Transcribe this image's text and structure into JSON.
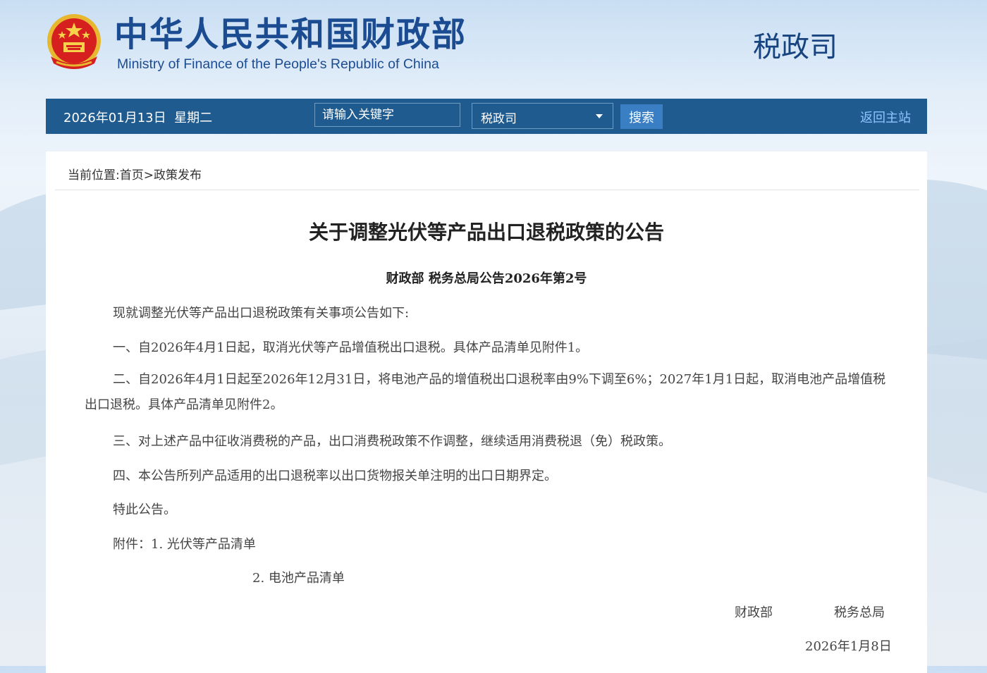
{
  "header": {
    "cn_title": "中华人民共和国财政部",
    "en_title": "Ministry of Finance of the People's Republic of China",
    "department": "税政司",
    "emblem_icon": "national-emblem-icon"
  },
  "navbar": {
    "date": "2026年01月13日",
    "weekday": "星期二",
    "search_placeholder": "请输入关键字",
    "scope_selected": "税政司",
    "search_button": "搜索",
    "home_link": "返回主站"
  },
  "breadcrumb": {
    "prefix": "当前位置:",
    "home": "首页",
    "separator": ">",
    "current": "政策发布"
  },
  "article": {
    "title": "关于调整光伏等产品出口退税政策的公告",
    "doc_number": "财政部 税务总局公告2026年第2号",
    "intro": "现就调整光伏等产品出口退税政策有关事项公告如下:",
    "item1": "一、自2026年4月1日起，取消光伏等产品增值税出口退税。具体产品清单见附件1。",
    "item2": "二、自2026年4月1日起至2026年12月31日，将电池产品的增值税出口退税率由9%下调至6%；2027年1月1日起，取消电池产品增值税出口退税。具体产品清单见附件2。",
    "item3": "三、对上述产品中征收消费税的产品，出口消费税政策不作调整，继续适用消费税退（免）税政策。",
    "item4": "四、本公告所列产品适用的出口退税率以出口货物报关单注明的出口日期界定。",
    "closing": "特此公告。",
    "attachments_label": "附件：",
    "attachment1": "1. 光伏等产品清单",
    "attachment2": "2. 电池产品清单",
    "signer1": "财政部",
    "signer2": "税务总局",
    "date": "2026年1月8日"
  },
  "colors": {
    "navbar": "#1f5b8f",
    "title_blue": "#1b4c92",
    "search_button": "#3a7fc4",
    "home_link": "#8ec4ff"
  }
}
